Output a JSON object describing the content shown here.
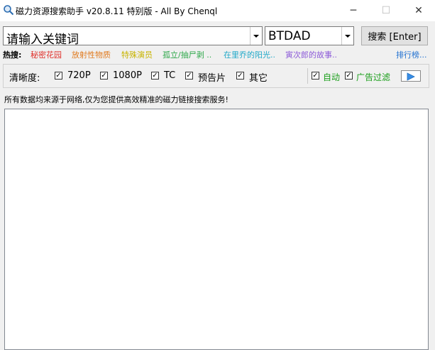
{
  "window": {
    "title": "磁力资源搜索助手 v20.8.11 特别版 - All By Chenql",
    "minimize_glyph": "─",
    "maximize_glyph": "☐",
    "close_glyph": "✕"
  },
  "search": {
    "keyword_value": "请输入关键词",
    "site_value": "BTDAD",
    "button_label": "搜索 [Enter]"
  },
  "hot": {
    "label": "热搜:",
    "items": [
      {
        "text": "秘密花园",
        "color": "#e0302a"
      },
      {
        "text": "放射性物质",
        "color": "#e07a1e"
      },
      {
        "text": "特殊演员",
        "color": "#c8b400"
      },
      {
        "text": "孤立/抽尸剥 ..",
        "color": "#2ea84a"
      },
      {
        "text": "在里乔的阳光..",
        "color": "#1fa8c8"
      },
      {
        "text": "寅次郎的故事..",
        "color": "#8c5ad8"
      }
    ],
    "rank_link": "排行榜...",
    "rank_color": "#1e6fd0"
  },
  "filters": {
    "label": "清晰度:",
    "options": [
      {
        "label": "720P",
        "checked": true
      },
      {
        "label": "1080P",
        "checked": true
      },
      {
        "label": "TC",
        "checked": true
      },
      {
        "label": "预告片",
        "checked": true
      },
      {
        "label": "其它",
        "checked": true
      }
    ],
    "auto_label": "自动",
    "auto_checked": true,
    "adfilter_label": "广告过滤",
    "adfilter_checked": true,
    "green": "#1a9e1a",
    "check_glyph": "✓"
  },
  "notice": "所有数据均来源于网络,仅为您提供高效精准的磁力链接搜索服务!"
}
